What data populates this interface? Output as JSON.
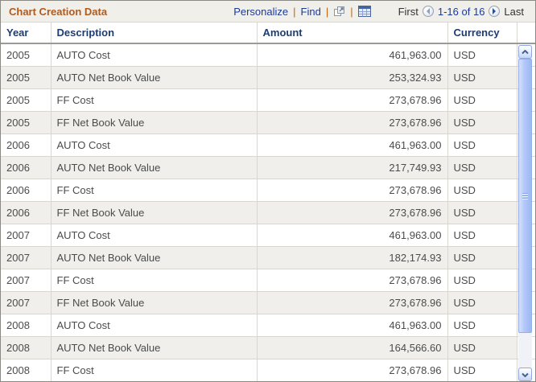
{
  "header": {
    "title": "Chart Creation Data",
    "toolbar": {
      "personalize_label": "Personalize",
      "find_label": "Find",
      "separator": "|",
      "view_all_icon": "popup-window-icon",
      "download_icon": "spreadsheet-grid-icon"
    },
    "pager": {
      "first_label": "First",
      "prev_icon": "previous-arrow-icon",
      "range_label": "1-16 of 16",
      "next_icon": "next-arrow-icon",
      "last_label": "Last"
    }
  },
  "table": {
    "columns": [
      "Year",
      "Description",
      "Amount",
      "Currency"
    ],
    "rows": [
      [
        "2005",
        "AUTO Cost",
        "461,963.00",
        "USD"
      ],
      [
        "2005",
        "AUTO Net Book Value",
        "253,324.93",
        "USD"
      ],
      [
        "2005",
        "FF Cost",
        "273,678.96",
        "USD"
      ],
      [
        "2005",
        "FF Net Book Value",
        "273,678.96",
        "USD"
      ],
      [
        "2006",
        "AUTO Cost",
        "461,963.00",
        "USD"
      ],
      [
        "2006",
        "AUTO Net Book Value",
        "217,749.93",
        "USD"
      ],
      [
        "2006",
        "FF Cost",
        "273,678.96",
        "USD"
      ],
      [
        "2006",
        "FF Net Book Value",
        "273,678.96",
        "USD"
      ],
      [
        "2007",
        "AUTO Cost",
        "461,963.00",
        "USD"
      ],
      [
        "2007",
        "AUTO Net Book Value",
        "182,174.93",
        "USD"
      ],
      [
        "2007",
        "FF Cost",
        "273,678.96",
        "USD"
      ],
      [
        "2007",
        "FF Net Book Value",
        "273,678.96",
        "USD"
      ],
      [
        "2008",
        "AUTO Cost",
        "461,963.00",
        "USD"
      ],
      [
        "2008",
        "AUTO Net Book Value",
        "164,566.60",
        "USD"
      ],
      [
        "2008",
        "FF Cost",
        "273,678.96",
        "USD"
      ]
    ]
  },
  "scrollbar": {
    "up_icon": "chevron-up-icon",
    "down_icon": "chevron-down-icon"
  },
  "colors": {
    "title_text": "#b25a1b",
    "link_text": "#1a3a9c",
    "separator_orange": "#b4641e",
    "column_header_text": "#1e3c70",
    "cell_text": "#4c4c4a",
    "alt_row_bg": "#f0efec",
    "titlebar_bg": "#f1efea",
    "scrollbar_thumb": "#b2c7f8"
  }
}
